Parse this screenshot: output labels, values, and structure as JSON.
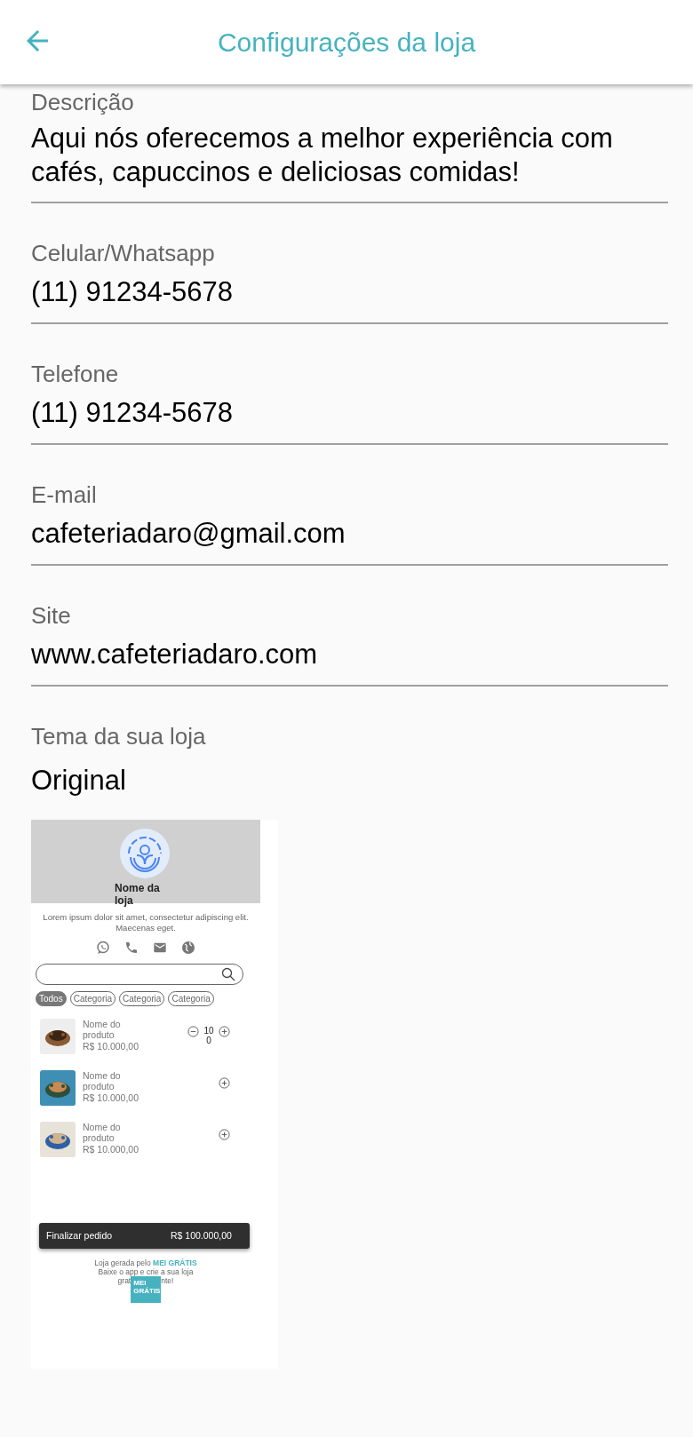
{
  "app_bar": {
    "title": "Configurações da loja"
  },
  "fields": [
    {
      "label": "Descrição",
      "value": "Aqui nós oferecemos a melhor experiência com cafés, capuccinos e deliciosas comidas!"
    },
    {
      "label": "Celular/Whatsapp",
      "value": "(11) 91234-5678"
    },
    {
      "label": "Telefone",
      "value": "(11) 91234-5678"
    },
    {
      "label": "E-mail",
      "value": "cafeteriadaro@gmail.com"
    },
    {
      "label": "Site",
      "value": "www.cafeteriadaro.com"
    }
  ],
  "theme": {
    "label": "Tema da sua loja",
    "value": "Original"
  },
  "preview": {
    "store_name": "Nome da loja",
    "description": "Lorem ipsum dolor sit amet, consectetur adipiscing elit. Maecenas eget.",
    "categories": [
      {
        "label": "Todos",
        "selected": true
      },
      {
        "label": "Categoria",
        "selected": false
      },
      {
        "label": "Categoria",
        "selected": false
      },
      {
        "label": "Categoria",
        "selected": false
      }
    ],
    "products": [
      {
        "name": "Nome do produto",
        "price": "R$ 10.000,00",
        "quantity": "100"
      },
      {
        "name": "Nome do produto",
        "price": "R$ 10.000,00"
      },
      {
        "name": "Nome do produto",
        "price": "R$ 10.000,00"
      }
    ],
    "checkout": {
      "label": "Finalizar pedido",
      "total": "R$ 100.000,00"
    },
    "footer": {
      "credit": "Loja gerada pelo **MEI GRÁTIS**",
      "line_2": "Baixe o app e crie a sua loja",
      "line_3_start": "grat",
      "line_3_end": "nte!",
      "logo_text": "MEI GRÁTIS"
    }
  }
}
